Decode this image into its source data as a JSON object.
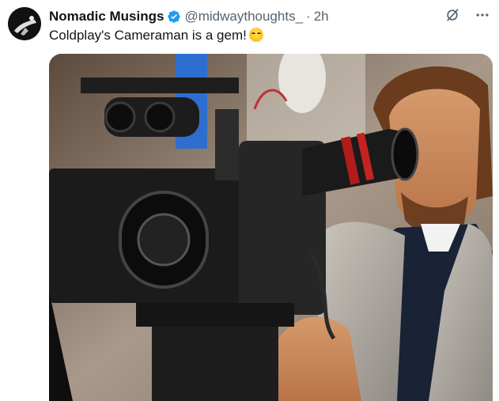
{
  "tweet": {
    "display_name": "Nomadic Musings",
    "handle": "@midwaythoughts_",
    "separator": "·",
    "time": "2h",
    "text": "Coldplay's Cameraman is a gem!",
    "emoji": "face-with-tears-of-joy",
    "media_alt": "Photo of a man looking through a large film camera viewfinder"
  },
  "icons": {
    "verified": "verified-badge-icon",
    "grok": "grok-icon",
    "more": "more-icon"
  },
  "colors": {
    "verified": "#1d9bf0",
    "secondary_text": "#536471",
    "primary_text": "#0f1419"
  }
}
